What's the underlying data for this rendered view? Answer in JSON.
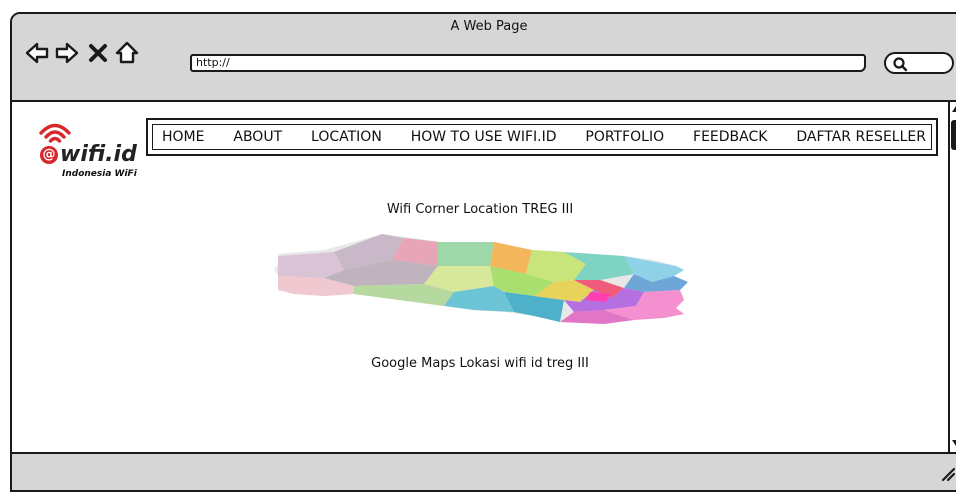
{
  "browser": {
    "title": "A Web Page",
    "address": "http://",
    "search_icon": "search-icon"
  },
  "logo": {
    "name": "wifi.id",
    "tagline": "Indonesia WiFi"
  },
  "menu": {
    "items": [
      "HOME",
      "ABOUT",
      "LOCATION",
      "HOW TO USE WIFI.ID",
      "PORTFOLIO",
      "FEEDBACK",
      "DAFTAR RESELLER"
    ]
  },
  "main": {
    "map_heading": "Wifi Corner Location TREG III",
    "map_caption": "Google Maps Lokasi wifi id treg III"
  },
  "colors": {
    "chrome": "#d6d6d6",
    "brand_red": "#d7262c"
  }
}
